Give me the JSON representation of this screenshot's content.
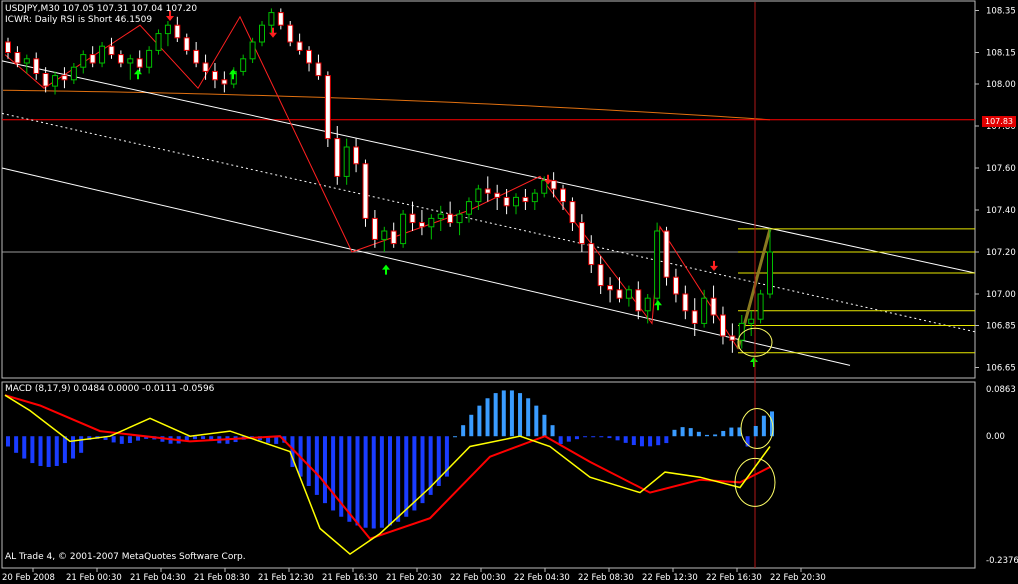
{
  "header": {
    "symbol_line": "USDJPY,M30  107.05 107.31 107.04 107.20",
    "indicator_line": "ICWR: Daily RSI is Short 46.1509"
  },
  "macd": {
    "label": "MACD  (8,17,9) 0.0484 0.0000 -0.0111 -0.0596"
  },
  "footer": {
    "copyright": "AL Trade 4, © 2001-2007 MetaQuotes Software Corp."
  },
  "current_price_tag": "107.83",
  "colors": {
    "background": "#000000",
    "bull_candle": "#00c000",
    "bear_candle": "#ffffff",
    "zigzag": "#ff2020",
    "buy_arrow": "#00ff00",
    "sell_arrow": "#ff2020",
    "channel": "#ffffff",
    "fib": "#e8e800",
    "ma_line": "#e07010",
    "horizontal_red": "#ff0000",
    "macd_hist_neg": "#1a3cff",
    "macd_hist_pos": "#3a9cff",
    "macd_signal_red": "#ff0000",
    "macd_yellow": "#ffff00",
    "vline": "#b01818",
    "circle": "#ffff66"
  },
  "chart_data": {
    "type": "candlestick",
    "price_axis": {
      "ticks": [
        "108.35",
        "108.15",
        "108.00",
        "107.80",
        "107.60",
        "107.40",
        "107.20",
        "107.00",
        "106.85",
        "106.65"
      ]
    },
    "macd_axis": {
      "ticks": [
        "0.0863",
        "0.00",
        "-0.2376"
      ]
    },
    "x_axis": {
      "ticks": [
        "20 Feb 2008",
        "21 Feb 00:30",
        "21 Feb 04:30",
        "21 Feb 08:30",
        "21 Feb 12:30",
        "21 Feb 16:30",
        "21 Feb 20:30",
        "22 Feb 00:30",
        "22 Feb 04:30",
        "22 Feb 08:30",
        "22 Feb 12:30",
        "22 Feb 16:30",
        "22 Feb 20:30"
      ]
    },
    "candles": [
      [
        108.2,
        108.22,
        108.12,
        108.15
      ],
      [
        108.15,
        108.18,
        108.08,
        108.1
      ],
      [
        108.1,
        108.14,
        108.05,
        108.12
      ],
      [
        108.12,
        108.15,
        108.02,
        108.05
      ],
      [
        108.05,
        108.08,
        107.96,
        107.99
      ],
      [
        107.99,
        108.06,
        107.95,
        108.04
      ],
      [
        108.04,
        108.08,
        107.98,
        108.02
      ],
      [
        108.02,
        108.1,
        108.0,
        108.08
      ],
      [
        108.08,
        108.16,
        108.05,
        108.14
      ],
      [
        108.14,
        108.18,
        108.08,
        108.1
      ],
      [
        108.1,
        108.2,
        108.08,
        108.18
      ],
      [
        108.18,
        108.22,
        108.12,
        108.14
      ],
      [
        108.14,
        108.16,
        108.08,
        108.1
      ],
      [
        108.1,
        108.14,
        108.02,
        108.12
      ],
      [
        108.12,
        108.16,
        108.05,
        108.08
      ],
      [
        108.08,
        108.18,
        108.05,
        108.16
      ],
      [
        108.16,
        108.26,
        108.14,
        108.24
      ],
      [
        108.24,
        108.3,
        108.18,
        108.28
      ],
      [
        108.28,
        108.32,
        108.2,
        108.22
      ],
      [
        108.22,
        108.24,
        108.14,
        108.16
      ],
      [
        108.16,
        108.2,
        108.08,
        108.1
      ],
      [
        108.1,
        108.14,
        108.02,
        108.06
      ],
      [
        108.06,
        108.1,
        107.98,
        108.02
      ],
      [
        108.02,
        108.06,
        107.96,
        108.0
      ],
      [
        108.0,
        108.08,
        107.98,
        108.06
      ],
      [
        108.06,
        108.14,
        108.04,
        108.12
      ],
      [
        108.12,
        108.22,
        108.1,
        108.2
      ],
      [
        108.2,
        108.3,
        108.18,
        108.28
      ],
      [
        108.28,
        108.36,
        108.24,
        108.34
      ],
      [
        108.34,
        108.36,
        108.26,
        108.28
      ],
      [
        108.28,
        108.3,
        108.18,
        108.2
      ],
      [
        108.2,
        108.24,
        108.14,
        108.16
      ],
      [
        108.16,
        108.18,
        108.06,
        108.1
      ],
      [
        108.1,
        108.14,
        108.02,
        108.04
      ],
      [
        108.04,
        108.06,
        107.7,
        107.74
      ],
      [
        107.74,
        107.8,
        107.52,
        107.56
      ],
      [
        107.56,
        107.74,
        107.52,
        107.7
      ],
      [
        107.7,
        107.74,
        107.58,
        107.62
      ],
      [
        107.62,
        107.64,
        107.32,
        107.36
      ],
      [
        107.36,
        107.4,
        107.22,
        107.26
      ],
      [
        107.26,
        107.32,
        107.2,
        107.3
      ],
      [
        107.3,
        107.34,
        107.22,
        107.24
      ],
      [
        107.24,
        107.4,
        107.22,
        107.38
      ],
      [
        107.38,
        107.44,
        107.3,
        107.34
      ],
      [
        107.34,
        107.4,
        107.28,
        107.32
      ],
      [
        107.32,
        107.38,
        107.26,
        107.36
      ],
      [
        107.36,
        107.42,
        107.3,
        107.38
      ],
      [
        107.38,
        107.44,
        107.32,
        107.34
      ],
      [
        107.34,
        107.4,
        107.28,
        107.38
      ],
      [
        107.38,
        107.46,
        107.34,
        107.44
      ],
      [
        107.44,
        107.52,
        107.4,
        107.5
      ],
      [
        107.5,
        107.56,
        107.44,
        107.48
      ],
      [
        107.48,
        107.52,
        107.4,
        107.46
      ],
      [
        107.46,
        107.5,
        107.38,
        107.42
      ],
      [
        107.42,
        107.48,
        107.38,
        107.46
      ],
      [
        107.46,
        107.5,
        107.4,
        107.44
      ],
      [
        107.44,
        107.5,
        107.4,
        107.48
      ],
      [
        107.48,
        107.56,
        107.46,
        107.54
      ],
      [
        107.54,
        107.58,
        107.46,
        107.5
      ],
      [
        107.5,
        107.52,
        107.4,
        107.44
      ],
      [
        107.44,
        107.46,
        107.3,
        107.34
      ],
      [
        107.34,
        107.38,
        107.2,
        107.24
      ],
      [
        107.24,
        107.28,
        107.1,
        107.14
      ],
      [
        107.14,
        107.18,
        107.0,
        107.04
      ],
      [
        107.04,
        107.08,
        106.96,
        107.02
      ],
      [
        107.02,
        107.08,
        106.96,
        106.98
      ],
      [
        106.98,
        107.04,
        106.94,
        107.02
      ],
      [
        107.02,
        107.06,
        106.88,
        106.92
      ],
      [
        106.92,
        107.0,
        106.86,
        106.98
      ],
      [
        106.98,
        107.34,
        106.96,
        107.3
      ],
      [
        107.3,
        107.32,
        107.04,
        107.08
      ],
      [
        107.08,
        107.12,
        106.96,
        107.0
      ],
      [
        107.0,
        107.04,
        106.88,
        106.92
      ],
      [
        106.92,
        106.98,
        106.8,
        106.86
      ],
      [
        106.86,
        107.02,
        106.84,
        106.98
      ],
      [
        106.98,
        107.04,
        106.86,
        106.9
      ],
      [
        106.9,
        106.94,
        106.76,
        106.8
      ],
      [
        106.8,
        106.86,
        106.72,
        106.78
      ],
      [
        106.78,
        106.9,
        106.74,
        106.86
      ],
      [
        106.86,
        106.92,
        106.8,
        106.88
      ],
      [
        106.88,
        107.02,
        106.86,
        107.0
      ],
      [
        107.0,
        107.31,
        106.98,
        107.2
      ]
    ],
    "overlays": {
      "moving_average": "orange",
      "regression_channel": "white",
      "fibonacci_levels": [
        "107.31",
        "107.20",
        "107.10",
        "106.92",
        "106.85",
        "106.72"
      ],
      "horizontal_level": 107.83
    },
    "macd": {
      "fast": 8,
      "slow": 17,
      "signal": 9,
      "values_shown": [
        0.0484,
        0.0,
        -0.0111,
        -0.0596
      ],
      "range": [
        -0.2376,
        0.0863
      ]
    }
  }
}
